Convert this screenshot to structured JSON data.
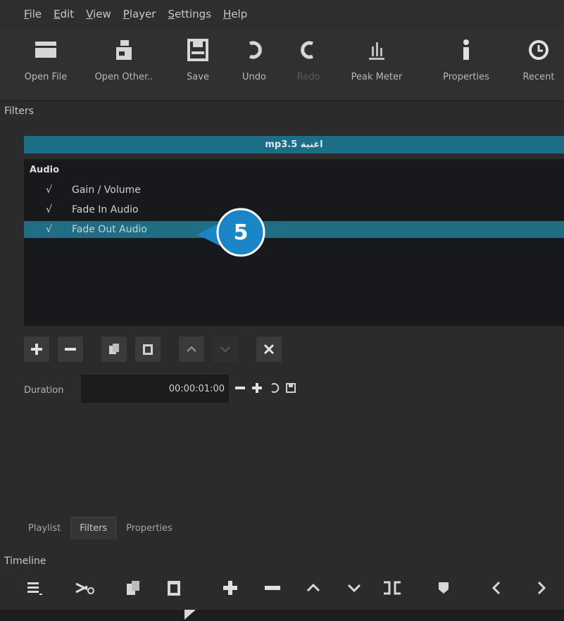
{
  "menu": [
    "File",
    "Edit",
    "View",
    "Player",
    "Settings",
    "Help"
  ],
  "toolbar": [
    {
      "label": "Open File",
      "icon": "folder-icon",
      "disabled": false
    },
    {
      "label": "Open Other..",
      "icon": "open-other-icon",
      "disabled": false
    },
    {
      "label": "Save",
      "icon": "save-icon",
      "disabled": false
    },
    {
      "label": "Undo",
      "icon": "undo-icon",
      "disabled": false
    },
    {
      "label": "Redo",
      "icon": "redo-icon",
      "disabled": true
    },
    {
      "label": "Peak Meter",
      "icon": "peak-meter-icon",
      "disabled": false
    },
    {
      "label": "Properties",
      "icon": "info-icon",
      "disabled": false
    },
    {
      "label": "Recent",
      "icon": "clock-icon",
      "disabled": false
    }
  ],
  "filters": {
    "title": "Filters",
    "clip_name": "mp3.5 اغنية",
    "group": "Audio",
    "check_mark": "√",
    "items": [
      {
        "label": "Gain / Volume",
        "checked": true,
        "selected": false
      },
      {
        "label": "Fade In Audio",
        "checked": true,
        "selected": false
      },
      {
        "label": "Fade Out Audio",
        "checked": true,
        "selected": true
      }
    ],
    "callout_number": "5",
    "duration_label": "Duration",
    "duration_value": "00:00:01:00"
  },
  "tabs": [
    {
      "label": "Playlist",
      "active": false
    },
    {
      "label": "Filters",
      "active": true
    },
    {
      "label": "Properties",
      "active": false
    }
  ],
  "timeline": {
    "title": "Timeline"
  },
  "colors": {
    "accent": "#1f6e86",
    "callout": "#1b86c7",
    "panel": "#18191d",
    "background": "#2b2b2b"
  }
}
